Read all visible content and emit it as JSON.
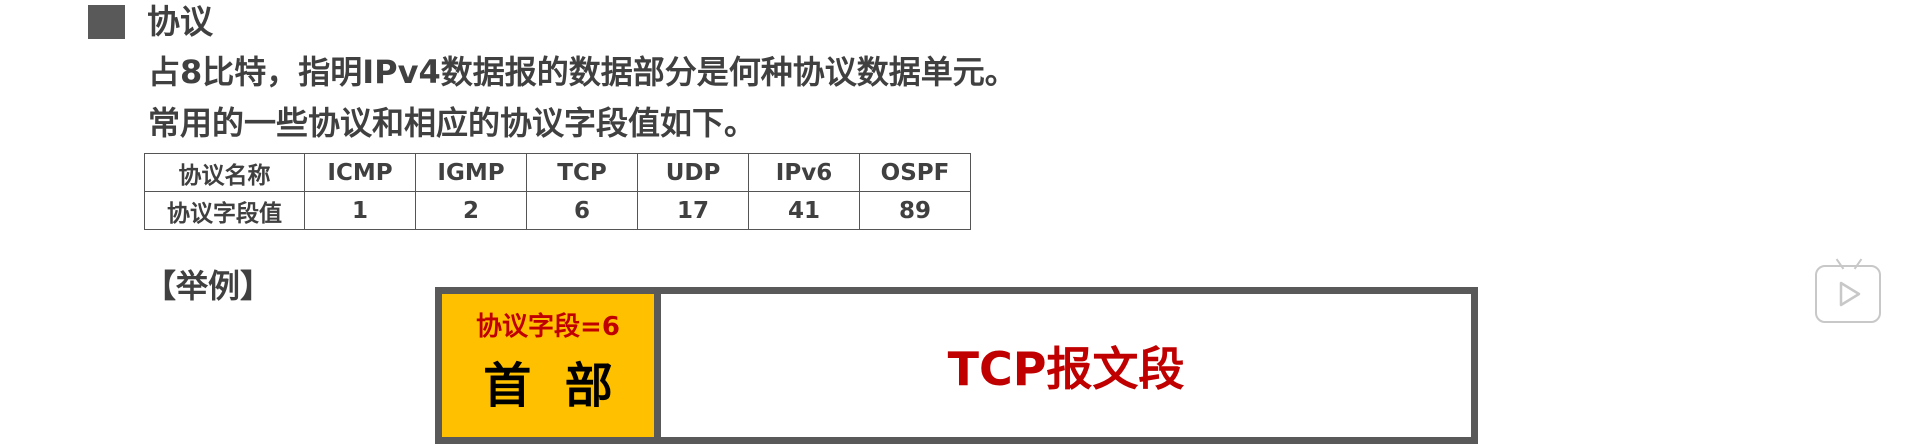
{
  "section": {
    "title": "协议",
    "description_line1": "占8比特，指明IPv4数据报的数据部分是何种协议数据单元。",
    "description_line2": "常用的一些协议和相应的协议字段值如下。"
  },
  "table": {
    "row_headers": [
      "协议名称",
      "协议字段值"
    ],
    "protocols": [
      "ICMP",
      "IGMP",
      "TCP",
      "UDP",
      "IPv6",
      "OSPF"
    ],
    "values": [
      "1",
      "2",
      "6",
      "17",
      "41",
      "89"
    ]
  },
  "example": {
    "label": "【举例】",
    "header_field": "协议字段=6",
    "header_label": "首  部",
    "body_label": "TCP报文段"
  },
  "icons": {
    "bullet": "square-bullet-icon",
    "player": "play-icon"
  },
  "colors": {
    "text": "#404040",
    "header_fill": "#ffc000",
    "accent_red": "#c00000",
    "border": "#595959"
  }
}
